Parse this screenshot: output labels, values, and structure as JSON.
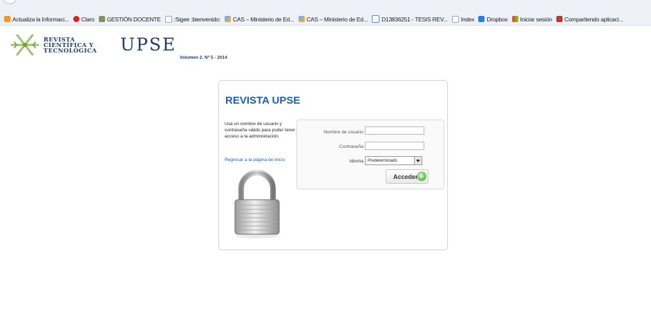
{
  "bookmarks": [
    {
      "label": "Actualiza la Informaci...",
      "icon": "orange-star-icon"
    },
    {
      "label": "Claro",
      "icon": "claro-icon"
    },
    {
      "label": "GESTIÓN DOCENTE",
      "icon": "graduation-icon"
    },
    {
      "label": ":Sigee :bienvenido:",
      "icon": "blank-page-icon"
    },
    {
      "label": "CAS – Ministerio de Ed...",
      "icon": "flag-icon"
    },
    {
      "label": "CAS – Ministerio de Ed...",
      "icon": "flag-icon"
    },
    {
      "label": "D13836251 - TESIS REV...",
      "icon": "document-icon"
    },
    {
      "label": "Index",
      "icon": "blank-page-icon"
    },
    {
      "label": "Dropbox",
      "icon": "dropbox-icon"
    },
    {
      "label": "Iniciar sesión",
      "icon": "microsoft-icon"
    },
    {
      "label": "Compartiendo aplicaci...",
      "icon": "share-icon"
    }
  ],
  "header": {
    "logo_lines": [
      "REVISTA",
      "CIENTÍFICA Y",
      "TECNOLÓGICA"
    ],
    "brand": "UPSE",
    "volume": "Volumen 2. Nº 5 - 2014"
  },
  "login": {
    "title": "REVISTA UPSE",
    "description": "Usa un nombre de usuario y contraseña válido para poder tener acceso a la administración.",
    "home_link": "Regresar a la página de inicio",
    "username_label": "Nombre de usuario",
    "username_value": "",
    "password_label": "Contraseña",
    "password_value": "",
    "language_label": "Idioma",
    "language_value": "Predeterminado",
    "submit_label": "Acceder"
  },
  "colors": {
    "title_blue": "#1b5fae",
    "brand_navy": "#1f3d63",
    "accent_green": "#3fa82a"
  }
}
